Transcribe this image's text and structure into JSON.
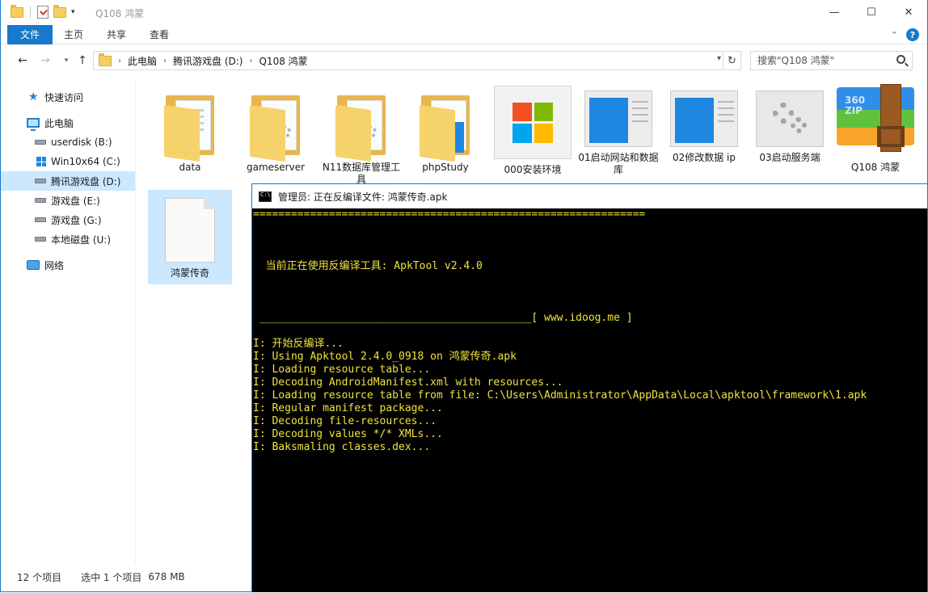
{
  "window": {
    "title": "Q108 鸿蒙",
    "minimize_icon": "minimize-icon",
    "maximize_icon": "maximize-icon",
    "close_icon": "close-icon"
  },
  "ribbon": {
    "tabs": [
      {
        "label": "文件",
        "active": true
      },
      {
        "label": "主页"
      },
      {
        "label": "共享"
      },
      {
        "label": "查看"
      }
    ],
    "accent": "#1979ca"
  },
  "address": {
    "crumbs": [
      "此电脑",
      "腾讯游戏盘 (D:)",
      "Q108 鸿蒙"
    ],
    "search_placeholder": "搜索\"Q108 鸿蒙\""
  },
  "nav": {
    "items": [
      {
        "label": "快速访问",
        "icon": "star-icon"
      },
      {
        "label": "此电脑",
        "icon": "computer-icon"
      },
      {
        "label": "userdisk (B:)",
        "icon": "drive-icon"
      },
      {
        "label": "Win10x64 (C:)",
        "icon": "windows-drive-icon"
      },
      {
        "label": "腾讯游戏盘 (D:)",
        "icon": "drive-icon",
        "selected": true
      },
      {
        "label": "游戏盘 (E:)",
        "icon": "drive-icon"
      },
      {
        "label": "游戏盘 (G:)",
        "icon": "drive-icon"
      },
      {
        "label": "本地磁盘 (U:)",
        "icon": "drive-icon"
      },
      {
        "label": "网络",
        "icon": "network-icon"
      }
    ]
  },
  "files": [
    {
      "name": "data",
      "icon": "folder-icon"
    },
    {
      "name": "gameserver",
      "icon": "folder-icon"
    },
    {
      "name": "N11数据库管理工具",
      "icon": "folder-icon"
    },
    {
      "name": "phpStudy",
      "icon": "folder-icon"
    },
    {
      "name": "000安装环境",
      "icon": "windows-logo-icon"
    },
    {
      "name": "01启动网站和数据库",
      "icon": "shortcut-thumbnail-icon"
    },
    {
      "name": "02修改数据 ip",
      "icon": "shortcut-thumbnail-icon"
    },
    {
      "name": "03启动服务端",
      "icon": "gear-thumbnail-icon"
    },
    {
      "name": "Q108 鸿蒙",
      "icon": "zip-archive-icon"
    },
    {
      "name": "鸿蒙传奇",
      "icon": "blank-file-icon",
      "selected": true
    }
  ],
  "status": {
    "count": "12 个项目",
    "selection": "选中 1 个项目",
    "size": "678 MB"
  },
  "console": {
    "title": "管理员: 正在反编译文件: 鸿蒙传奇.apk",
    "text_color": "#f0e33c",
    "lines": [
      "==============================================================",
      "",
      "",
      "",
      "  当前正在使用反编译工具: ApkTool v2.4.0",
      "",
      "",
      "",
      " ___________________________________________[ www.idoog.me ]",
      "",
      "I: 开始反编译...",
      "I: Using Apktool 2.4.0_0918 on 鸿蒙传奇.apk",
      "I: Loading resource table...",
      "I: Decoding AndroidManifest.xml with resources...",
      "I: Loading resource table from file: C:\\Users\\Administrator\\AppData\\Local\\apktool\\framework\\1.apk",
      "I: Regular manifest package...",
      "I: Decoding file-resources...",
      "I: Decoding values */* XMLs...",
      "I: Baksmaling classes.dex..."
    ]
  }
}
